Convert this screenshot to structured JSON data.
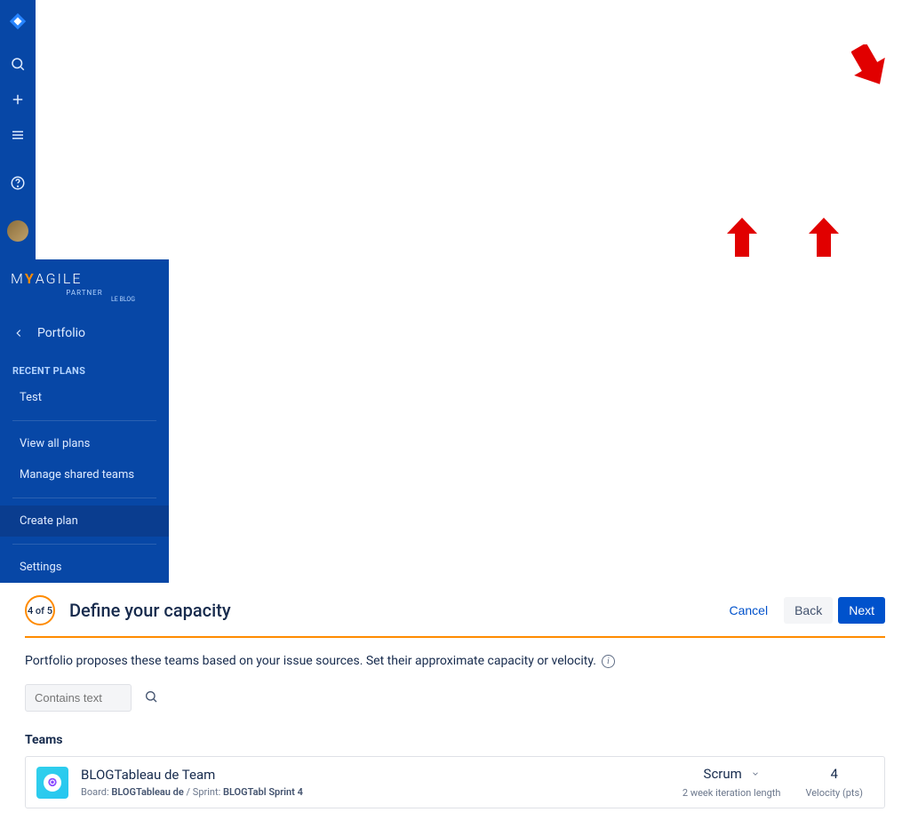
{
  "brand": {
    "text_prefix": "M",
    "text_mid": "Y",
    "text_rest": "AGILE",
    "partner": "PARTNER",
    "blog": "LE BLOG"
  },
  "sidebar": {
    "back_label": "Portfolio",
    "recent_header": "RECENT PLANS",
    "recent": [
      "Test"
    ],
    "items": [
      "View all plans",
      "Manage shared teams"
    ],
    "create": "Create plan",
    "settings": "Settings"
  },
  "wizard": {
    "step_label": "4 of 5",
    "title": "Define your capacity",
    "cancel": "Cancel",
    "back": "Back",
    "next": "Next",
    "intro": "Portfolio proposes these teams based on your issue sources. Set their approximate capacity or velocity."
  },
  "search": {
    "placeholder": "Contains text"
  },
  "teams_header": "Teams",
  "team": {
    "name": "BLOGTableau de Team",
    "board_label": "Board:",
    "board_value": "BLOGTableau de",
    "sprint_label": "Sprint:",
    "sprint_value": "BLOGTabl Sprint 4",
    "type": "Scrum",
    "iter_sub": "2 week iteration length",
    "velocity": "4",
    "velocity_sub": "Velocity (pts)"
  }
}
